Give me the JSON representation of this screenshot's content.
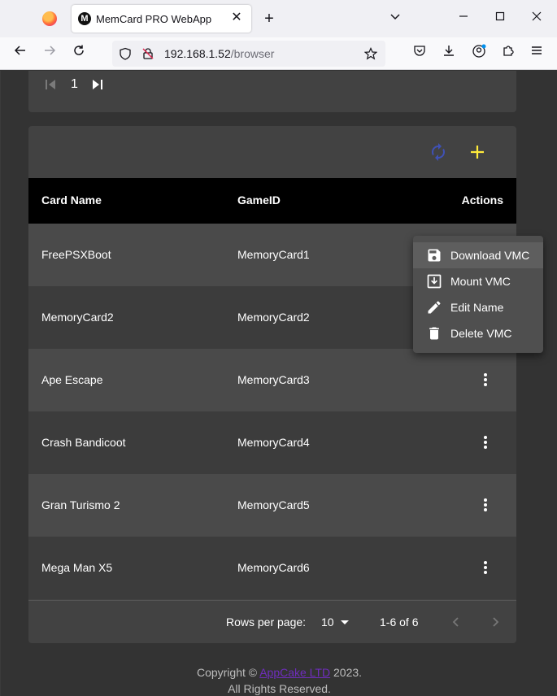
{
  "browser": {
    "tab_title": "MemCard PRO WebApp",
    "url_host": "192.168.1.52",
    "url_path": "/browser"
  },
  "pager": {
    "current_page": "1"
  },
  "table": {
    "headers": {
      "card_name": "Card Name",
      "game_id": "GameID",
      "actions": "Actions"
    },
    "rows": [
      {
        "card_name": "FreePSXBoot",
        "game_id": "MemoryCard1"
      },
      {
        "card_name": "MemoryCard2",
        "game_id": "MemoryCard2"
      },
      {
        "card_name": "Ape Escape",
        "game_id": "MemoryCard3"
      },
      {
        "card_name": "Crash Bandicoot",
        "game_id": "MemoryCard4"
      },
      {
        "card_name": "Gran Turismo 2",
        "game_id": "MemoryCard5"
      },
      {
        "card_name": "Mega Man X5",
        "game_id": "MemoryCard6"
      }
    ],
    "footer": {
      "rows_per_page_label": "Rows per page:",
      "rows_per_page_value": "10",
      "range": "1-6 of 6"
    }
  },
  "context_menu": {
    "items": [
      {
        "label": "Download VMC",
        "icon": "save-icon"
      },
      {
        "label": "Mount VMC",
        "icon": "download-box-icon"
      },
      {
        "label": "Edit Name",
        "icon": "pencil-icon"
      },
      {
        "label": "Delete VMC",
        "icon": "trash-icon"
      }
    ]
  },
  "footer": {
    "copyright_prefix": "Copyright ©",
    "company": "AppCake LTD",
    "year": "2023.",
    "rights": "All Rights Reserved."
  },
  "colors": {
    "refresh_icon": "#3f51b5",
    "add_icon": "#ffeb3b",
    "page_background": "#333333",
    "card_background": "#424242",
    "header_background": "#000000"
  }
}
